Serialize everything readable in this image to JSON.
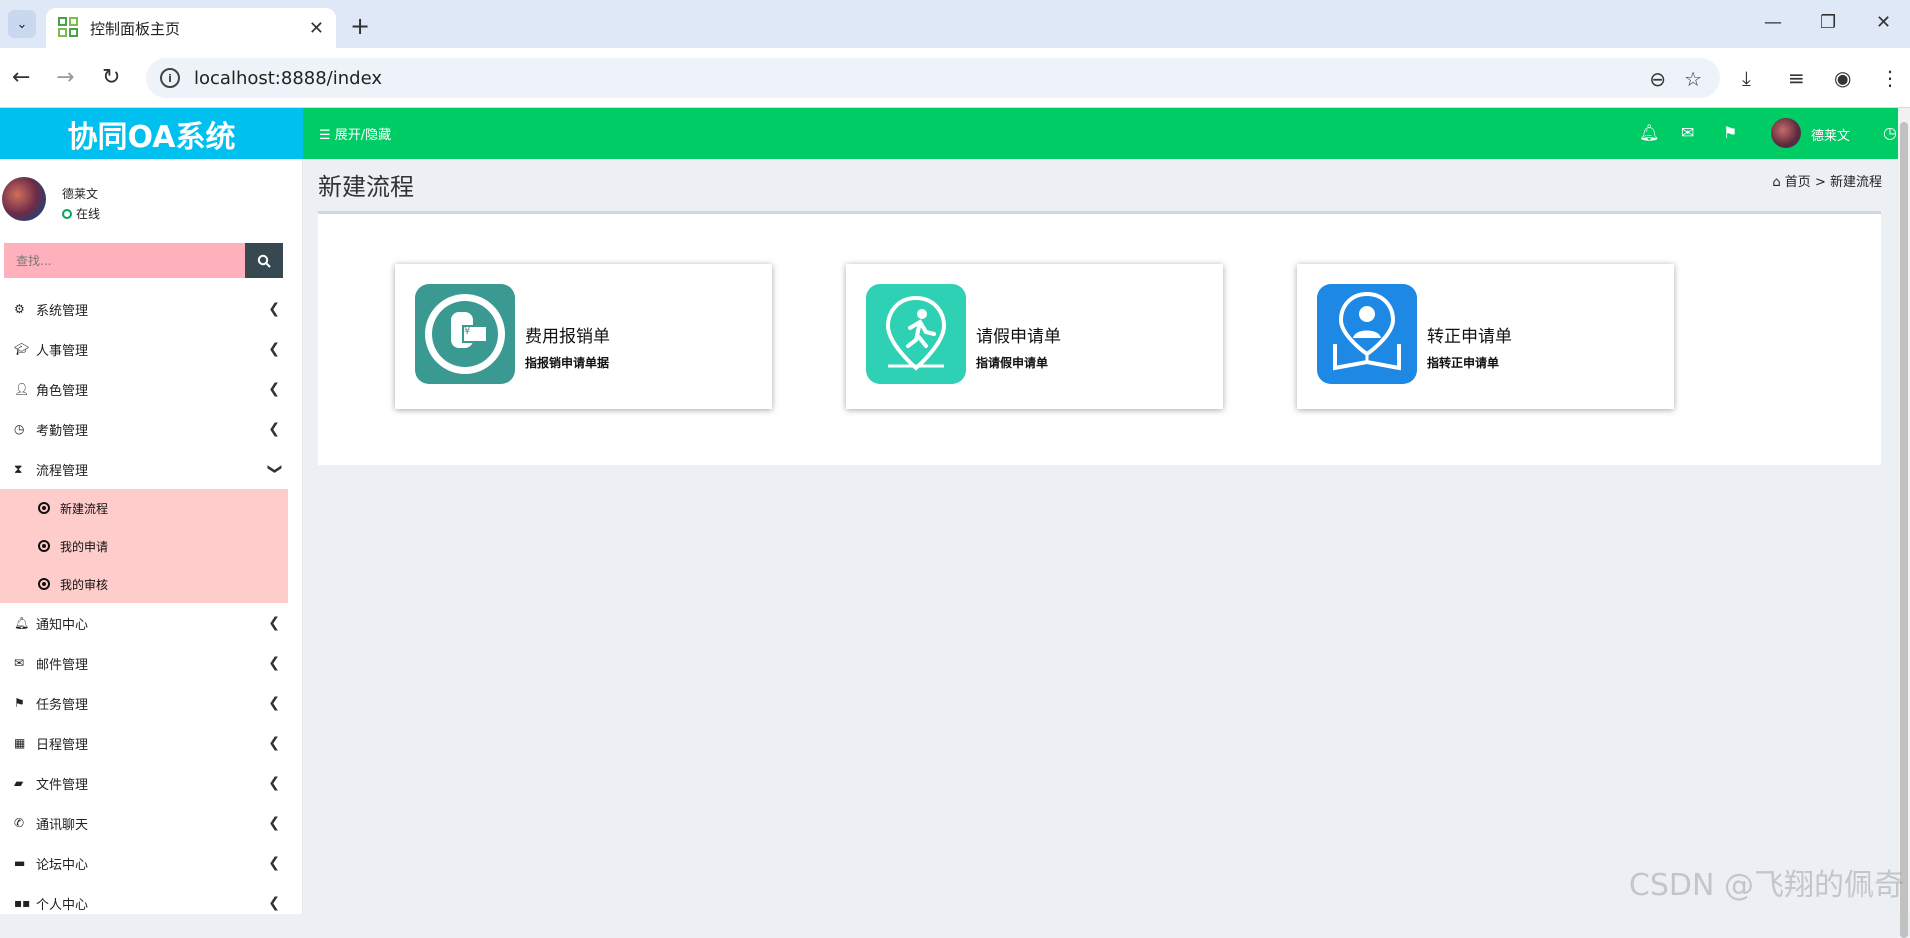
{
  "browser": {
    "tab_title": "控制面板主页",
    "url": "localhost:8888/index"
  },
  "app": {
    "logo": "协同OA系统",
    "toggle_label": "展开/隐藏",
    "header_user": "德莱文"
  },
  "sidebar": {
    "user_name": "德莱文",
    "user_status": "在线",
    "search_placeholder": "查找...",
    "items": [
      {
        "label": "系统管理",
        "icon": "gear-icon"
      },
      {
        "label": "人事管理",
        "icon": "graduation-cap-icon"
      },
      {
        "label": "角色管理",
        "icon": "user-icon"
      },
      {
        "label": "考勤管理",
        "icon": "clock-icon"
      },
      {
        "label": "流程管理",
        "icon": "hourglass-icon",
        "expanded": true,
        "children": [
          "新建流程",
          "我的申请",
          "我的审核"
        ]
      },
      {
        "label": "通知中心",
        "icon": "bell-icon"
      },
      {
        "label": "邮件管理",
        "icon": "envelope-icon"
      },
      {
        "label": "任务管理",
        "icon": "flag-icon"
      },
      {
        "label": "日程管理",
        "icon": "calendar-icon"
      },
      {
        "label": "文件管理",
        "icon": "folder-icon"
      },
      {
        "label": "通讯聊天",
        "icon": "phone-icon"
      },
      {
        "label": "论坛中心",
        "icon": "comment-icon"
      },
      {
        "label": "个人中心",
        "icon": "grid-icon"
      }
    ]
  },
  "content": {
    "page_title": "新建流程",
    "breadcrumb_home": "首页",
    "breadcrumb_sep": ">",
    "breadcrumb_current": "新建流程",
    "cards": [
      {
        "title": "费用报销单",
        "desc": "指报销申请单据",
        "icon": "expense-icon",
        "color": "#3a9a92"
      },
      {
        "title": "请假申请单",
        "desc": "指请假申请单",
        "icon": "leave-icon",
        "color": "#2ed1b4"
      },
      {
        "title": "转正申请单",
        "desc": "指转正申请单",
        "icon": "regularization-icon",
        "color": "#1e88e5"
      }
    ]
  },
  "watermark": "CSDN @飞翔的佩奇",
  "colors": {
    "logo_bg": "#00c0ef",
    "header_bg": "#00cc66",
    "submenu_bg": "#ffcccc",
    "search_bg": "#ffb0bd"
  }
}
